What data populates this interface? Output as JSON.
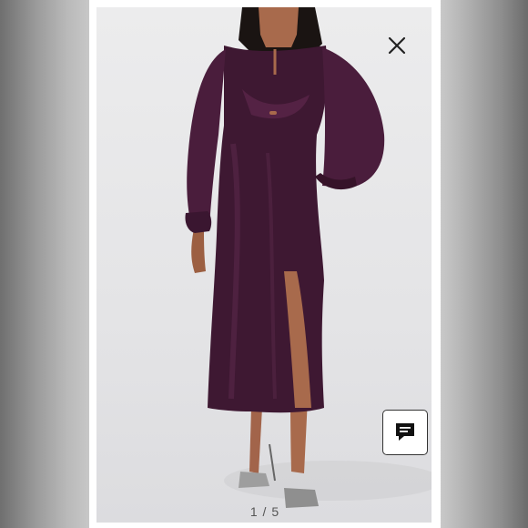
{
  "viewer": {
    "counter": "1 / 5",
    "close_icon": "close-icon",
    "chat_icon": "chat-bubble-icon"
  },
  "colors": {
    "dress": "#3e1832",
    "backdrop": "#e6e6e8",
    "frame": "#ffffff"
  }
}
